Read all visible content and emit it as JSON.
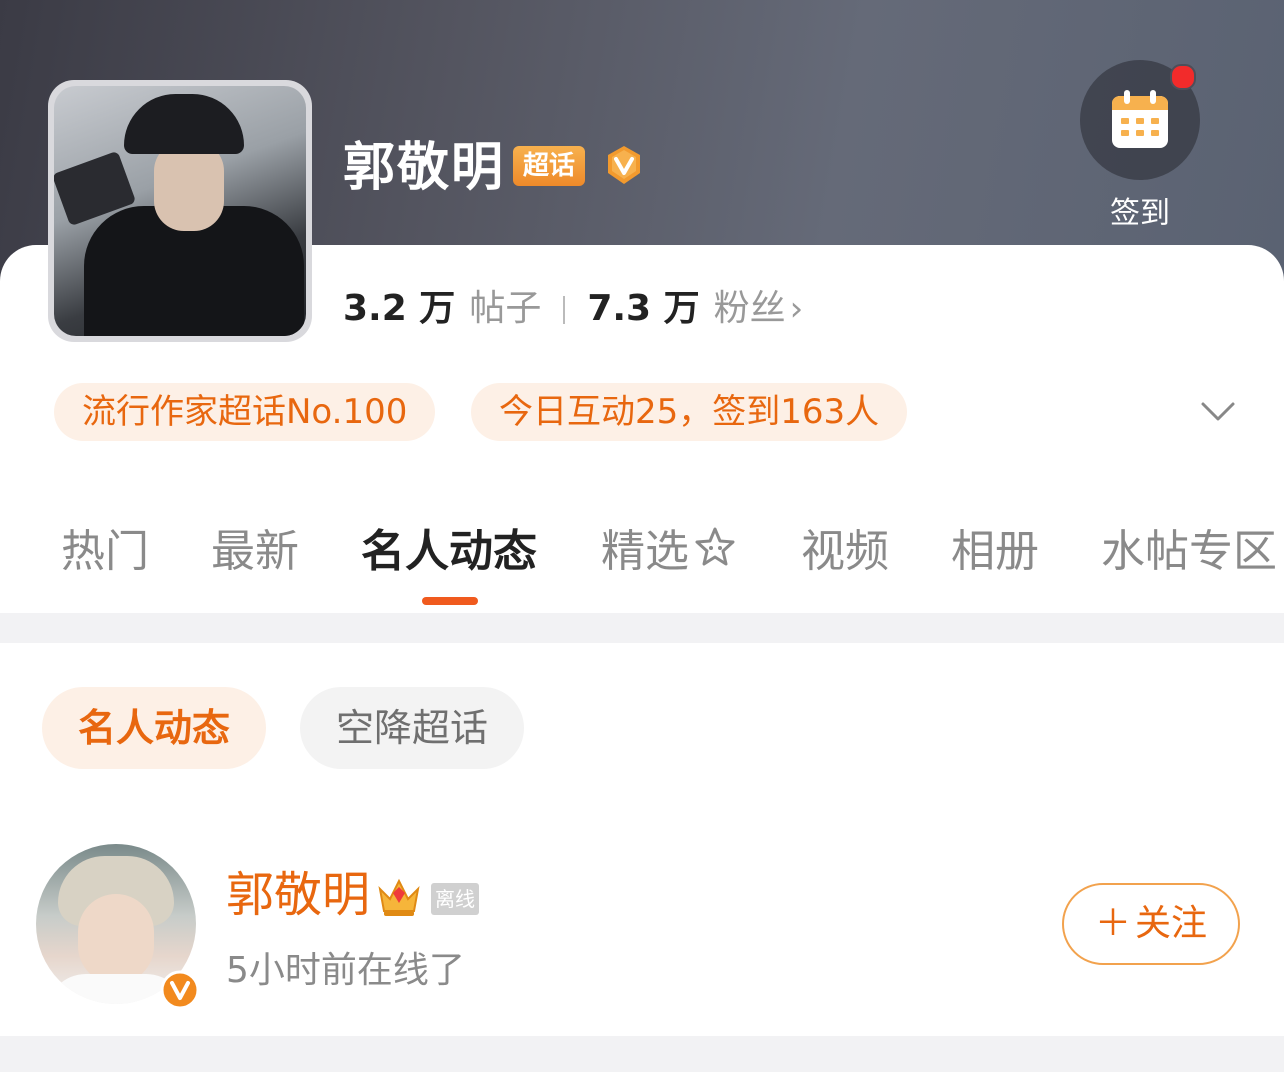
{
  "topic": {
    "name": "郭敬明",
    "badge": "超话",
    "signin_label": "签到",
    "posts_count": "3.2 万",
    "posts_label": "帖子",
    "fans_count": "7.3 万",
    "fans_label": "粉丝"
  },
  "pills": {
    "rank": "流行作家超话No.100",
    "today": "今日互动25，签到163人"
  },
  "tabs": [
    "热门",
    "最新",
    "名人动态",
    "精选",
    "视频",
    "相册",
    "水帖专区"
  ],
  "active_tab": "名人动态",
  "subfilters": {
    "active": "名人动态",
    "inactive": "空降超话"
  },
  "celebrity": {
    "name": "郭敬明",
    "status_badge": "离线",
    "last_online": "5小时前在线了",
    "follow_label": "关注"
  },
  "colors": {
    "accent": "#e8670f",
    "pill_bg": "#fdf0e6",
    "notification_dot": "#f22b2b"
  }
}
